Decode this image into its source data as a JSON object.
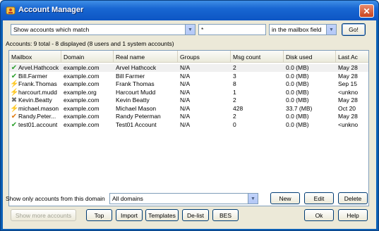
{
  "window": {
    "title": "Account Manager",
    "close_glyph": "✕"
  },
  "filter": {
    "match_select": "Show accounts which match",
    "pattern_value": "*",
    "field_select": "in the mailbox field",
    "go_label": "Go!"
  },
  "summary": {
    "text": "Accounts:  9 total - 8 displayed (8 users and 1 system accounts)"
  },
  "columns": [
    "Mailbox",
    "Domain",
    "Real name",
    "Groups",
    "Msg count",
    "Disk used",
    "Last Ac"
  ],
  "accounts": [
    {
      "mailbox": "Arvel.Hathcock",
      "domain": "example.com",
      "real_name": "Arvel Hathcock",
      "groups": "N/A",
      "msg_count": "2",
      "disk_used": "0.0 (MB)",
      "last": "May 28",
      "icon": "check",
      "icon_glyph": "✔",
      "icon_color": "#2ea12e",
      "selected": true
    },
    {
      "mailbox": "Bill.Farmer",
      "domain": "example.com",
      "real_name": "Bill Farmer",
      "groups": "N/A",
      "msg_count": "3",
      "disk_used": "0.0 (MB)",
      "last": "May 28",
      "icon": "check",
      "icon_glyph": "✔",
      "icon_color": "#2ea12e"
    },
    {
      "mailbox": "Frank.Thomas",
      "domain": "example.com",
      "real_name": "Frank Thomas",
      "groups": "N/A",
      "msg_count": "8",
      "disk_used": "0.0 (MB)",
      "last": "Sep 15",
      "icon": "lightning",
      "icon_glyph": "⚡",
      "icon_color": "#e08a00"
    },
    {
      "mailbox": "harcourt.mudd",
      "domain": "example.org",
      "real_name": "Harcourt Mudd",
      "groups": "N/A",
      "msg_count": "1",
      "disk_used": "0.0 (MB)",
      "last": "<unkno",
      "icon": "lightning",
      "icon_glyph": "⚡",
      "icon_color": "#e08a00"
    },
    {
      "mailbox": "Kevin.Beatty",
      "domain": "example.com",
      "real_name": "Kevin Beatty",
      "groups": "N/A",
      "msg_count": "2",
      "disk_used": "0.0 (MB)",
      "last": "May 28",
      "icon": "disabled-x",
      "icon_glyph": "✖",
      "icon_color": "#6b6b6b"
    },
    {
      "mailbox": "michael.mason",
      "domain": "example.com",
      "real_name": "Michael Mason",
      "groups": "N/A",
      "msg_count": "428",
      "disk_used": "33.7 (MB)",
      "last": "Oct 20",
      "icon": "lightning",
      "icon_glyph": "⚡",
      "icon_color": "#e08a00"
    },
    {
      "mailbox": "Randy.Peter...",
      "domain": "example.com",
      "real_name": "Randy Peterman",
      "groups": "N/A",
      "msg_count": "2",
      "disk_used": "0.0 (MB)",
      "last": "May 28",
      "icon": "check-orange",
      "icon_glyph": "✔",
      "icon_color": "#e07a10"
    },
    {
      "mailbox": "test01.account",
      "domain": "example.com",
      "real_name": "Test01 Account",
      "groups": "N/A",
      "msg_count": "0",
      "disk_used": "0.0 (MB)",
      "last": "<unkno",
      "icon": "check",
      "icon_glyph": "✔",
      "icon_color": "#2ea12e"
    }
  ],
  "domain_filter": {
    "label": "Show only accounts from this domain",
    "select": "All domains"
  },
  "actions": {
    "new": "New",
    "edit": "Edit",
    "delete": "Delete",
    "show_more": "Show more accounts",
    "top": "Top",
    "import": "Import",
    "templates": "Templates",
    "delist": "De-list",
    "bes": "BES",
    "ok": "Ok",
    "help": "Help"
  }
}
